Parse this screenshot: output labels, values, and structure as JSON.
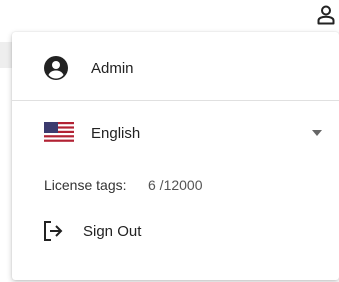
{
  "header": {
    "user_icon": "person-outline-icon"
  },
  "menu": {
    "user": {
      "icon": "account-circle-icon",
      "name": "Admin"
    },
    "language": {
      "flag": "us-flag-icon",
      "label": "English",
      "dropdown_icon": "caret-down-icon"
    },
    "license": {
      "label": "License tags:",
      "value": "6 /12000"
    },
    "signout": {
      "icon": "sign-out-icon",
      "label": "Sign Out"
    }
  },
  "colors": {
    "text": "#222222",
    "divider": "#e0e0e0",
    "flag_red": "#b22234",
    "flag_blue": "#3c3b6e"
  }
}
